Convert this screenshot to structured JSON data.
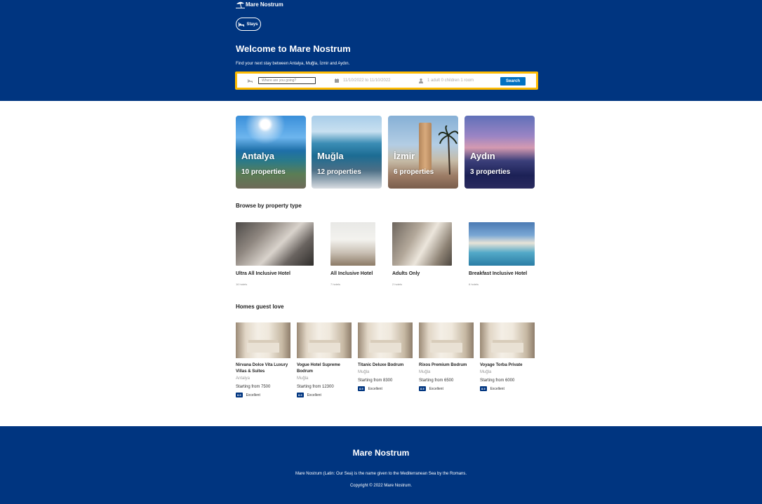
{
  "header": {
    "logo_text": "Mare Nostrum",
    "nav": {
      "stays_label": "Stays"
    },
    "welcome": "Welcome to Mare Nostrum",
    "subtitle": "Find your next stay between Antalya, Muğla, İzmir and Aydın."
  },
  "search": {
    "destination_placeholder": "Where are you going?",
    "dates": "11/10/2022 to 11/10/2022",
    "occupancy": "1 adult 0 children 1 room",
    "button_label": "Search"
  },
  "cities": [
    {
      "name": "Antalya",
      "count": "10 properties"
    },
    {
      "name": "Muğla",
      "count": "12 properties"
    },
    {
      "name": "İzmir",
      "count": "6 properties"
    },
    {
      "name": "Aydın",
      "count": "3 properties"
    }
  ],
  "property_section_title": "Browse by property type",
  "property_types": [
    {
      "name": "Ultra All Inclusive Hotel",
      "count": "16 hotels"
    },
    {
      "name": "All Inclusive Hotel",
      "count": "7 hotels"
    },
    {
      "name": "Adults Only",
      "count": "2 hotels"
    },
    {
      "name": "Breakfast Inclusive Hotel",
      "count": "6 hotels"
    }
  ],
  "homes_section_title": "Homes guest love",
  "homes": [
    {
      "name": "Nirvana Dolce Vita Luxury Villas & Suites",
      "city": "Antalya",
      "price": "Starting from 7500",
      "score": "8.9",
      "rating_text": "Excellent"
    },
    {
      "name": "Vogue Hotel Supreme Bodrum",
      "city": "Muğla",
      "price": "Starting from 12300",
      "score": "8.9",
      "rating_text": "Excellent"
    },
    {
      "name": "Titanic Deluxe Bodrum",
      "city": "Muğla",
      "price": "Starting from 8300",
      "score": "8.9",
      "rating_text": "Excellent"
    },
    {
      "name": "Rixos Premium Bodrum",
      "city": "Muğla",
      "price": "Starting from 6500",
      "score": "8.9",
      "rating_text": "Excellent"
    },
    {
      "name": "Voyage Torba Private",
      "city": "Muğla",
      "price": "Starting from 6000",
      "score": "8.9",
      "rating_text": "Excellent"
    }
  ],
  "footer": {
    "title": "Mare Nostrum",
    "description": "Mare Nostrum (Latin: Our Sea) is the name given to the Mediterranean Sea by the Romans.",
    "copyright": "Copyright © 2022 Mare Nostrum."
  },
  "colors": {
    "brand": "#003580",
    "accent": "#febb02",
    "button": "#0071c2"
  },
  "icons": [
    "umbrella-beach-icon",
    "bed-icon",
    "calendar-icon",
    "person-icon"
  ]
}
